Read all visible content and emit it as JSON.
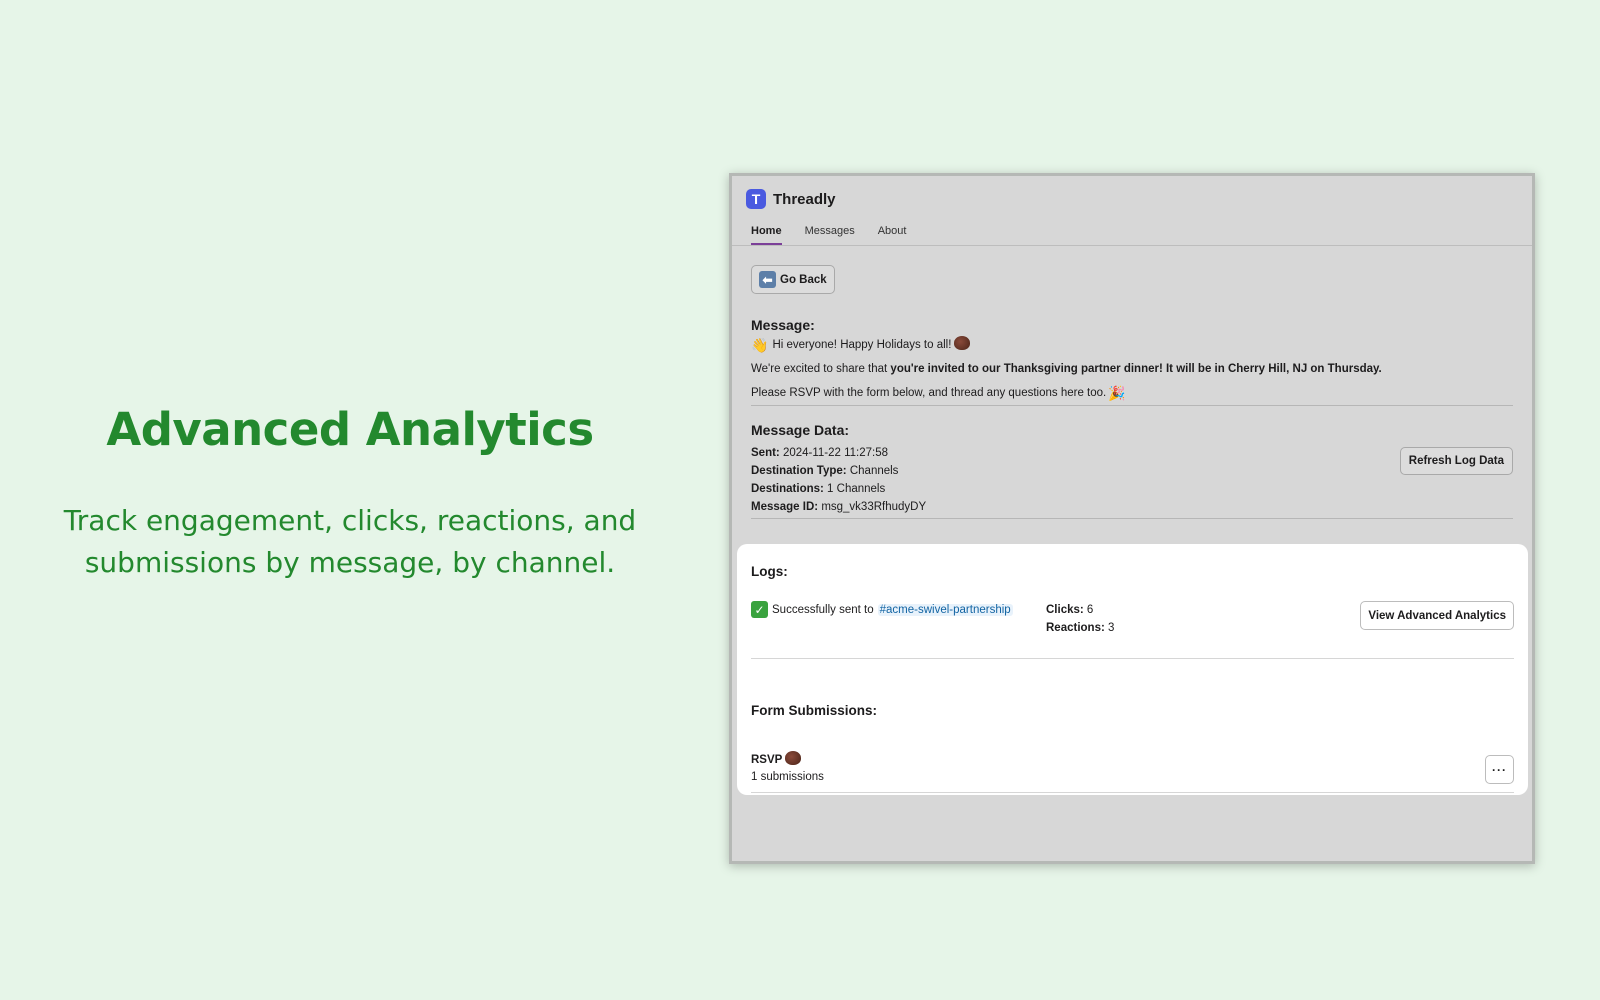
{
  "hero": {
    "title": "Advanced Analytics",
    "subtitle_line1": "Track engagement, clicks, reactions, and",
    "subtitle_line2": "submissions by message, by channel."
  },
  "app": {
    "logo_letter": "T",
    "name": "Threadly",
    "tabs": [
      {
        "label": "Home",
        "active": true
      },
      {
        "label": "Messages",
        "active": false
      },
      {
        "label": "About",
        "active": false
      }
    ],
    "back_icon": "back-arrow-icon",
    "back_label": "Go Back"
  },
  "message": {
    "title": "Message:",
    "line1": "Hi everyone! Happy Holidays to all!",
    "line2_plain": "We're excited to share that ",
    "line2_bold": "you're invited to our Thanksgiving partner dinner! It will be in Cherry Hill, NJ on Thursday.",
    "line3": "Please RSVP with the form below, and thread any questions here too."
  },
  "message_data": {
    "title": "Message Data:",
    "sent_key": "Sent:",
    "sent_val": "2024-11-22 11:27:58",
    "dest_type_key": "Destination Type:",
    "dest_type_val": "Channels",
    "destinations_key": "Destinations:",
    "destinations_val": "1 Channels",
    "message_id_key": "Message ID:",
    "message_id_val": "msg_vk33RfhudyDY",
    "refresh_label": "Refresh Log Data"
  },
  "logs": {
    "title": "Logs:",
    "status_text": "Successfully sent to",
    "channel": "#acme-swivel-partnership",
    "clicks_key": "Clicks:",
    "clicks_val": "6",
    "reactions_key": "Reactions:",
    "reactions_val": "3",
    "analytics_label": "View Advanced Analytics"
  },
  "forms": {
    "title": "Form Submissions:",
    "name": "RSVP",
    "count": "1 submissions",
    "more_label": "···"
  },
  "colors": {
    "background": "#e6f5e8",
    "hero_green": "#23892e",
    "logo_blue": "#4a5ae0",
    "active_tab": "#7b3f98",
    "link_blue": "#1264a3"
  }
}
